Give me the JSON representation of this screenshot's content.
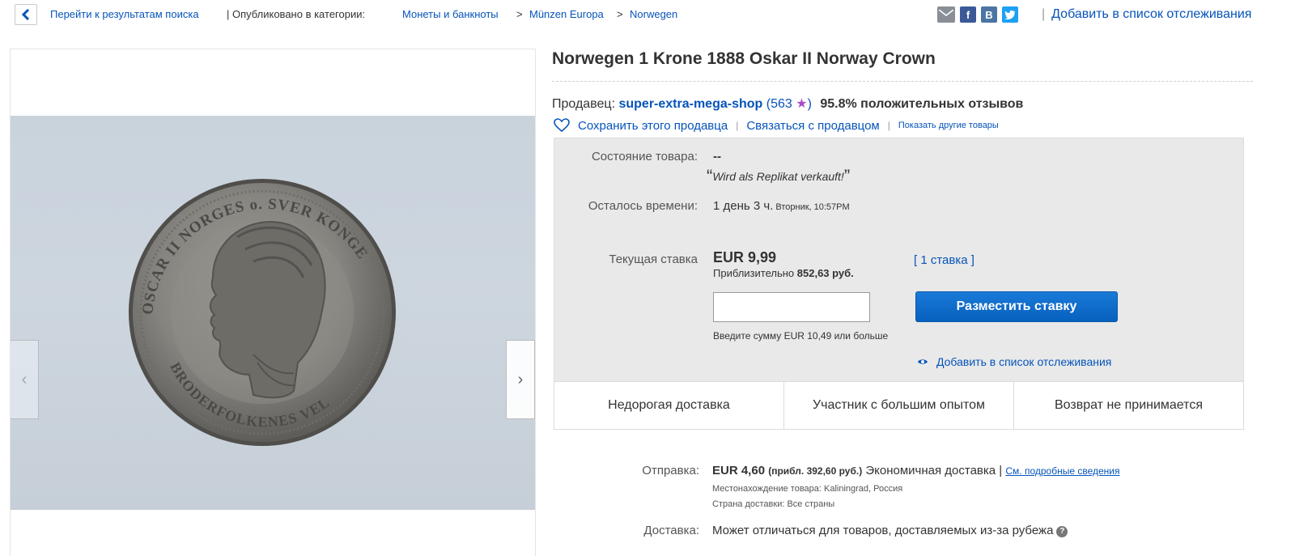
{
  "breadcrumb": {
    "back_results": "Перейти к результатам поиска",
    "published_in": "| Опубликовано в категории:",
    "categories": [
      "Монеты и банкноты",
      "Münzen Europa",
      "Norwegen"
    ],
    "separator": ">"
  },
  "share": {
    "icons": [
      "mail-icon",
      "facebook-icon",
      "vk-icon",
      "twitter-icon"
    ],
    "fb_glyph": "f",
    "vk_glyph": "B",
    "tw_glyph": "t"
  },
  "watchlist_top": "Добавить в список отслеживания",
  "listing": {
    "title": "Norwegen 1 Krone 1888 Oskar II Norway Crown"
  },
  "seller": {
    "label": "Продавец:",
    "name": "super-extra-mega-shop",
    "rating_open": "(563",
    "rating_close": ")",
    "feedback": "95.8% положительных отзывов",
    "save_seller": "Сохранить этого продавца",
    "contact": "Связаться с продавцом",
    "other_items": "Показать другие товары"
  },
  "item": {
    "condition_label": "Состояние товара:",
    "condition_value": "--",
    "condition_note": "Wird als Replikat verkauft!",
    "time_left_label": "Осталось времени:",
    "time_left": "1 день 3 ч.",
    "end_time": "Вторник, 10:57PM",
    "current_bid_label": "Текущая ставка",
    "current_bid": "EUR 9,99",
    "approx_label": "Приблизительно",
    "approx_value": "852,63 руб.",
    "bids_count": "1 ставка",
    "bid_input_value": "",
    "place_bid": "Разместить ставку",
    "bid_hint": "Введите сумму EUR 10,49 или больше",
    "add_watch": "Добавить в список отслеживания"
  },
  "features": [
    "Недорогая доставка",
    "Участник с большим опытом",
    "Возврат не принимается"
  ],
  "shipping": {
    "label": "Отправка:",
    "price": "EUR 4,60",
    "approx": "(прибл. 392,60 руб.)",
    "method": "Экономичная доставка |",
    "details_link": "См. подробные сведения",
    "location": "Местонахождение товара:  Kaliningrad, Россия",
    "ships_to": "Страна доставки:  Все страны",
    "delivery_label": "Доставка:",
    "delivery_value": "Может отличаться для товаров, доставляемых из-за рубежа"
  },
  "colors": {
    "link": "#0654ba",
    "button": "#0d6fcc",
    "star": "#a94ec6",
    "box_bg": "#e9e9e9"
  }
}
